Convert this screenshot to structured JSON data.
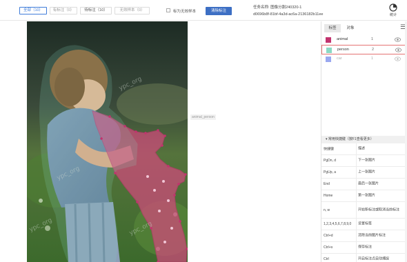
{
  "filters": {
    "all": "全部（10）",
    "labeled": "有标注（0）",
    "unlabeled": "待标注（10）",
    "invalid": "无效样本（0）"
  },
  "mark_invalid_label": "标为无效样本",
  "clear_button": "清除标注",
  "task": {
    "name_label": "任务名称:",
    "name_value": "图像分割240320-1",
    "id": "d0696b8f-81bf-4a3d-ac6a-2136182b11ee"
  },
  "stats_label": "统计",
  "right_panel": {
    "tabs": [
      "标签",
      "对象"
    ],
    "labels": [
      {
        "name": "animal",
        "count": "1",
        "color": "#c2336e",
        "visible": true
      },
      {
        "name": "person",
        "count": "2",
        "color": "#8ad9c3",
        "visible": true,
        "selected": true
      },
      {
        "name": "car",
        "count": "1",
        "color": "#9aa8f0",
        "visible": true,
        "muted": true
      }
    ],
    "shortcut_header": "常用快捷键（按F1查看更多）",
    "shortcuts": [
      {
        "key": "快捷键",
        "desc": "描述"
      },
      {
        "key": "PgDn, d",
        "desc": "下一张图片"
      },
      {
        "key": "PgUp, a",
        "desc": "上一张图片"
      },
      {
        "key": "End",
        "desc": "最后一张图片"
      },
      {
        "key": "Home",
        "desc": "第一张图片"
      },
      {
        "key": "n, w",
        "desc": "开始新标注或取消当前标注"
      },
      {
        "key": "1,2,3,4,5,6,7,8,9,0",
        "desc": "设置标签"
      },
      {
        "key": "Ctrl+d",
        "desc": "清除当前图片标注"
      },
      {
        "key": "Ctrl+s",
        "desc": "保存标注"
      },
      {
        "key": "Ctrl",
        "desc": "开启标注点自动捕捉"
      }
    ]
  },
  "canvas": {
    "floating_label": "animal_person",
    "watermark": "ypc_org"
  },
  "colors": {
    "accent": "#3d7bd9",
    "animal": "#c2336e",
    "person": "#8ad9c3"
  }
}
